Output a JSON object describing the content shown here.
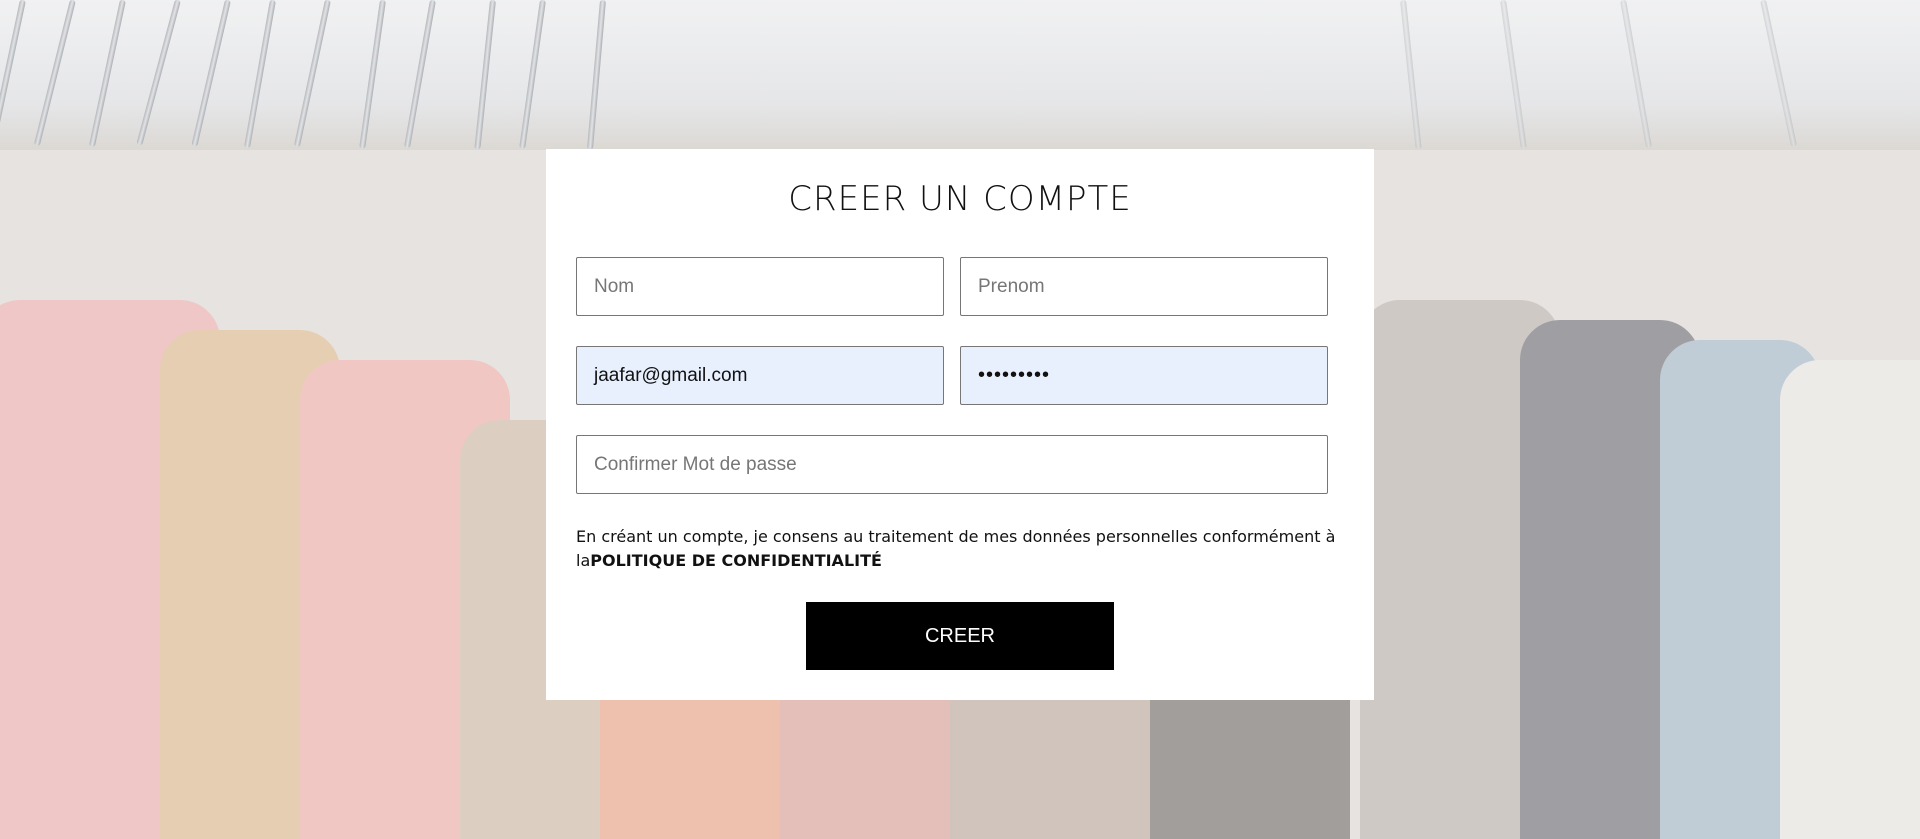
{
  "form": {
    "title": "CREER UN COMPTE",
    "nom_placeholder": "Nom",
    "prenom_placeholder": "Prenom",
    "email_value": "jaafar@gmail.com",
    "password_value": "•••••••••",
    "confirm_placeholder": "Confirmer Mot de passe",
    "consent_text": "En créant un compte, je consens au traitement de mes données personnelles conformément à la",
    "policy_link": "POLITIQUE DE CONFIDENTIALITÉ",
    "submit_label": "CREER"
  },
  "colors": {
    "card_background": "#ffffff",
    "autofill_background": "#e8f0fe",
    "button_background": "#000000",
    "button_text": "#ffffff"
  }
}
